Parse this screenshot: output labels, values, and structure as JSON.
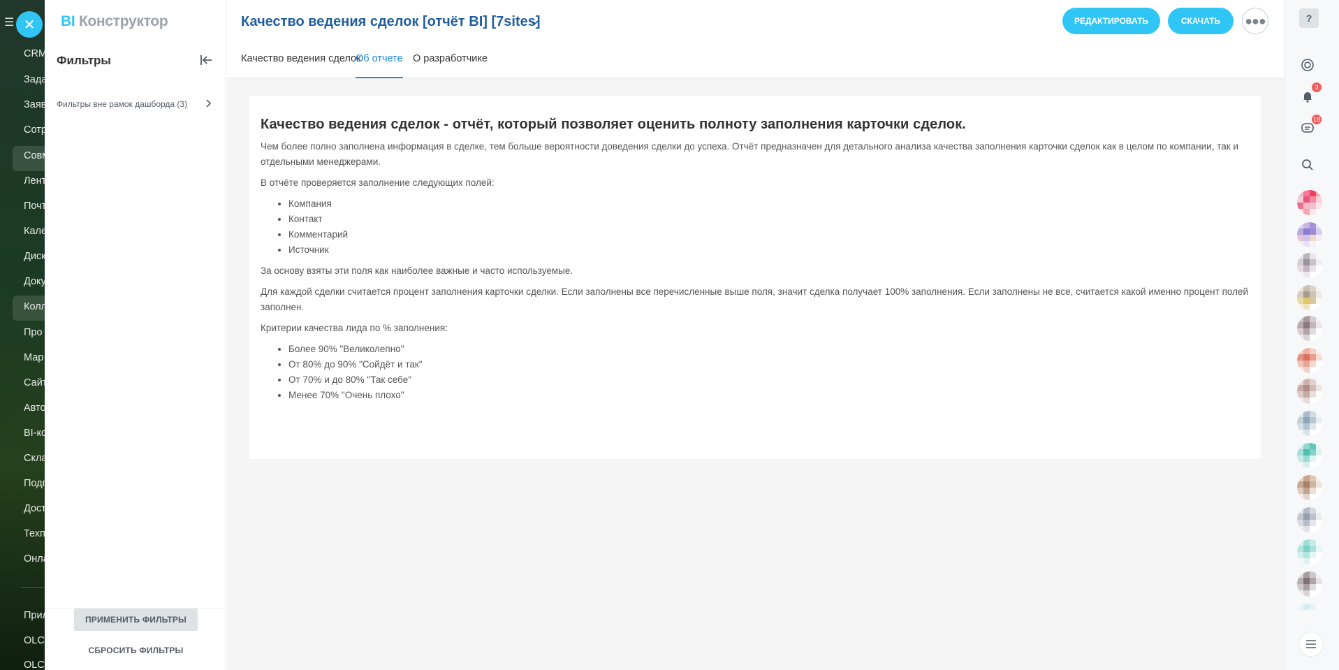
{
  "bitrix_menu": {
    "items": [
      "CRM",
      "Зада",
      "Заяв",
      "Сотр",
      "Совм",
      "Лент",
      "Почт",
      "Кале",
      "Диск",
      "Доку",
      "Колл",
      "Про",
      "Мар",
      "Сайт",
      "Авто",
      "BI-ко",
      "Скла",
      "Подп",
      "Дост",
      "Техп",
      "Онла",
      "Прил",
      "OLCI",
      "OLCI"
    ]
  },
  "brand": {
    "bi": "BI",
    "name": "Конструктор"
  },
  "filters": {
    "title": "Фильтры",
    "item_label": "Фильтры вне рамок дашборда (3)",
    "apply_label": "ПРИМЕНИТЬ ФИЛЬТРЫ",
    "reset_label": "СБРОСИТЬ ФИЛЬТРЫ"
  },
  "header": {
    "title": "Качество ведения сделок [отчёт BI] [7sites]",
    "edit_label": "РЕДАКТИРОВАТЬ",
    "download_label": "СКАЧАТЬ"
  },
  "tabs": [
    {
      "label": "Качество ведения сделок",
      "active": false
    },
    {
      "label": "Об отчете",
      "active": true
    },
    {
      "label": "О разработчике",
      "active": false
    }
  ],
  "article": {
    "heading": "Качество ведения сделок - отчёт, который позволяет оценить полноту заполнения карточки сделок.",
    "p1": "Чем более полно заполнена информация в сделке, тем больше вероятности доведения сделки до успеха. Отчёт предназначен для детального анализа качества заполнения карточки сделок как в целом по компании, так и отдельными менеджерами.",
    "p2": "В отчёте проверяется заполнение следующих полей:",
    "fields": [
      "Компания",
      "Контакт",
      "Комментарий",
      "Источник"
    ],
    "p3": "За основу взяты эти поля как наиболее важные и часто используемые.",
    "p4": "Для каждой сделки считается процент заполнения карточки сделки. Если заполнены все перечисленные выше поля, значит сделка получает 100% заполнения. Если заполнены не все, считается какой именно процент полей заполнен.",
    "p5": "Критерии качества лида по % заполнения:",
    "criteria": [
      "Более 90% \"Великолепно\"",
      "От 80% до 90% \"Сойдёт и так\"",
      "От 70% и до 80% \"Так себе\"",
      "Менее 70% \"Очень плохо\""
    ]
  },
  "rail": {
    "notifications_count": "3",
    "messages_count": "18"
  },
  "colors": {
    "accent": "#2fc6f6",
    "title_blue": "#1f5e9e",
    "tab_active": "#1f86d8"
  }
}
